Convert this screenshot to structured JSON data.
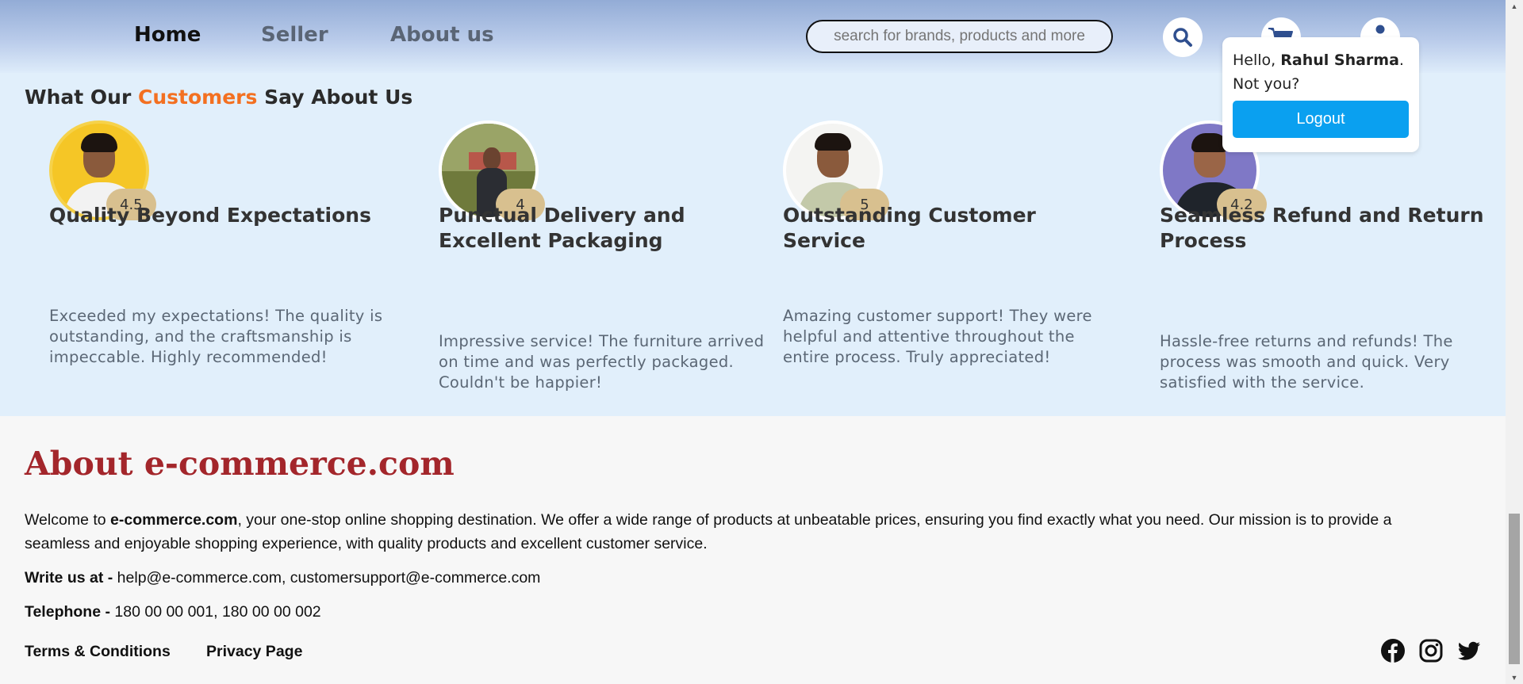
{
  "nav": {
    "links": [
      "Home",
      "Seller",
      "About us"
    ],
    "active": "Home",
    "search": {
      "placeholder": "search for brands, products and more"
    }
  },
  "user_popover": {
    "greeting": "Hello,",
    "name": "Rahul Sharma",
    "punct": ".",
    "not_you": "Not you?",
    "logout_label": "Logout"
  },
  "testimonials": {
    "heading_before": "What Our",
    "heading_accent": "Customers",
    "heading_after": "Say About Us",
    "accent_color": "#f37021",
    "cards": [
      {
        "rating": "4.5",
        "title": "Quality Beyond Expectations",
        "text": "Exceeded my expectations! The quality is outstanding, and the craftsmanship is impeccable. Highly recommended!"
      },
      {
        "rating": "4",
        "title": "Punctual Delivery and Excellent Packaging",
        "text": "Impressive service! The furniture arrived on time and was perfectly packaged. Couldn't be happier!"
      },
      {
        "rating": "5",
        "title": "Outstanding Customer Service",
        "text": "Amazing customer support! They were helpful and attentive throughout the entire process. Truly appreciated!"
      },
      {
        "rating": "4.2",
        "title": "Seamless Refund and Return Process",
        "text": "Hassle-free returns and refunds! The process was smooth and quick. Very satisfied with the service."
      }
    ]
  },
  "about": {
    "title": "About e-commerce.com",
    "intro_before": "Welcome to ",
    "intro_brand": "e-commerce.com",
    "intro_after": ", your one-stop online shopping destination. We offer a wide range of products at unbeatable prices, ensuring you find exactly what you need. Our mission is to provide a seamless and enjoyable shopping experience, with quality products and excellent customer service.",
    "write_label": "Write us at -",
    "write_value": "help@e-commerce.com, customersupport@e-commerce.com",
    "phone_label": "Telephone -",
    "phone_value": "180 00 00 001, 180 00 00 002",
    "links": [
      "Terms & Conditions",
      "Privacy Page"
    ]
  },
  "social_icons": [
    "facebook-icon",
    "instagram-icon",
    "twitter-icon"
  ],
  "colors": {
    "heading_red": "#a3262b",
    "logout_blue": "#0aa0f0",
    "rating_badge": "#d8c08f"
  }
}
